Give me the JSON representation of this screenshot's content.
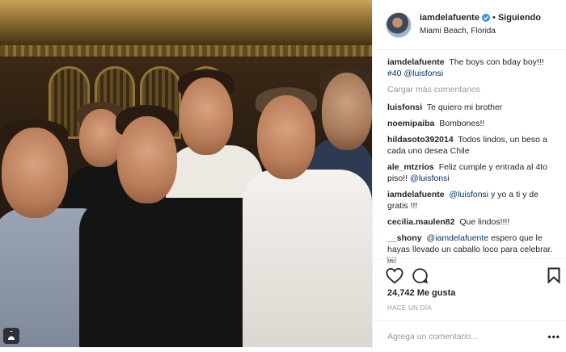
{
  "post": {
    "username": "iamdelafuente",
    "dot": "•",
    "follow_label": "Siguiendo",
    "location": "Miami Beach, Florida",
    "icons": {
      "verified": "verified-badge-icon",
      "multi": "multiple-photos-icon"
    }
  },
  "caption": {
    "user": "iamdelafuente",
    "text": "The boys con bday boy!!!",
    "hashtag": "#40",
    "mention": "@luisfonsi"
  },
  "load_more": "Cargar más comentarios",
  "comments": [
    {
      "user": "luisfonsi",
      "text": "Te quiero mi brother"
    },
    {
      "user": "noemipaiba",
      "text": "Bombones!!"
    },
    {
      "user": "hildasoto392014",
      "text": "Todos lindos, un beso a cada uno desea Chile"
    },
    {
      "user": "ale_mtzrios",
      "text": "Feliz cumple y entrada al 4to piso!!",
      "mention": "@luisfonsi"
    },
    {
      "user": "iamdelafuente",
      "mention": "@luisfonsi",
      "text": "y yo a ti y de gratis !!!"
    },
    {
      "user": "cecilia.maulen82",
      "text": "Que lindos!!!!"
    },
    {
      "user": "__shony",
      "mention": "@iamdelafuente",
      "text": "espero que le hayas llevado un caballo loco para celebrar. ￼"
    }
  ],
  "actions": {
    "likes": "24,742 Me gusta",
    "timestamp": "HACE UN DÍA",
    "comment_placeholder": "Agrega un comentario...",
    "more": "•••"
  },
  "colors": {
    "link": "#003569",
    "muted": "#999999",
    "verified": "#3897f0",
    "text": "#262626"
  }
}
